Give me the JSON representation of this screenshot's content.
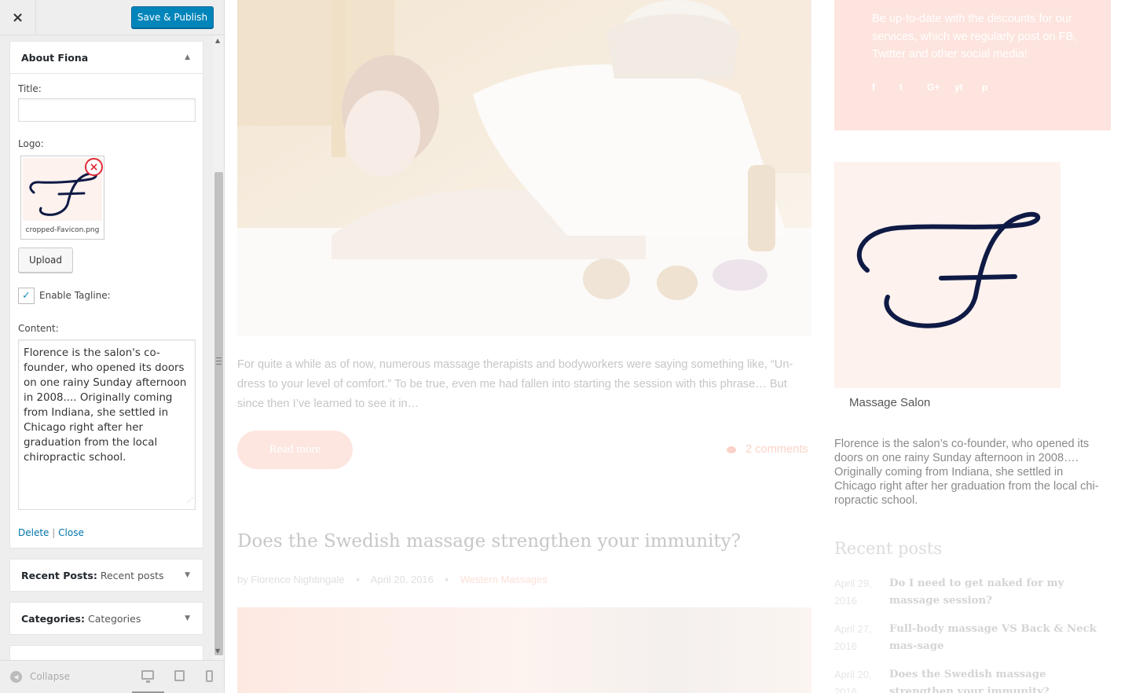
{
  "topbar": {
    "close_label": "×",
    "publish_label": "Save & Publish"
  },
  "widget_about": {
    "title": "About Fiona",
    "title_label": "Title:",
    "title_value": "",
    "logo_label": "Logo:",
    "logo_filename": "cropped-Favicon.png",
    "upload_label": "Upload",
    "tagline_label": "Enable Tagline:",
    "tagline_checked": true,
    "content_label": "Content:",
    "content_value": "Florence is the salon's co-founder, who opened its doors on one rainy Sunday afternoon in 2008.... Originally coming from Indiana, she settled in Chicago right after her graduation from the local chiropractic school.",
    "delete_label": "Delete",
    "separator": "|",
    "close_label": "Close"
  },
  "widget_recent": {
    "name": "Recent Posts:",
    "title": "Recent posts"
  },
  "widget_cats": {
    "name": "Categories:",
    "title": "Categories"
  },
  "bottombar": {
    "collapse_label": "Collapse"
  },
  "preview": {
    "promo_text": "Be up-to-date with the discounts for our services, which we regularly post on FB, Twitter and other social media!",
    "social": [
      "f",
      "t",
      "G+",
      "yt",
      "p"
    ],
    "excerpt": "For quite a while as of now, numerous massage therapists and bodyworkers were saying something like, “Un-dress to your level of comfort.” To be true, even me had fallen into starting the session with this phrase… But since then I’ve learned to see it in…",
    "read_more": "Read more",
    "comments": "2 comments",
    "post2_title": "Does the Swedish massage strengthen your immunity?",
    "post2_author": "by Florence Nightingale",
    "post2_date": "April 20, 2016",
    "post2_category": "Western Massages",
    "about_tagline": "Massage Salon",
    "about_text": "Florence is the salon’s co-founder, who opened its doors on one rainy Sunday afternoon in 2008…. Originally coming from Indiana, she settled in Chicago right after her graduation from the local chi-ropractic school.",
    "recent_title": "Recent posts",
    "recent_posts": [
      {
        "date": "April 29, 2016",
        "title": "Do I need to get naked for my massage session?"
      },
      {
        "date": "April 27, 2016",
        "title": "Full-body massage VS Back & Neck mas-sage"
      },
      {
        "date": "April 20, 2016",
        "title": "Does the Swedish massage strengthen your immunity?"
      }
    ]
  },
  "colors": {
    "accent": "#0085ba",
    "link": "#0073aa",
    "remove": "#e02a36",
    "brand_pink": "#fde4de",
    "logo_navy": "#0f1a45"
  },
  "icons": [
    "close-icon",
    "remove-icon",
    "checkmark-icon",
    "chevron-up-icon",
    "chevron-down-icon",
    "collapse-icon",
    "desktop-icon",
    "tablet-icon",
    "mobile-icon",
    "comment-icon"
  ]
}
